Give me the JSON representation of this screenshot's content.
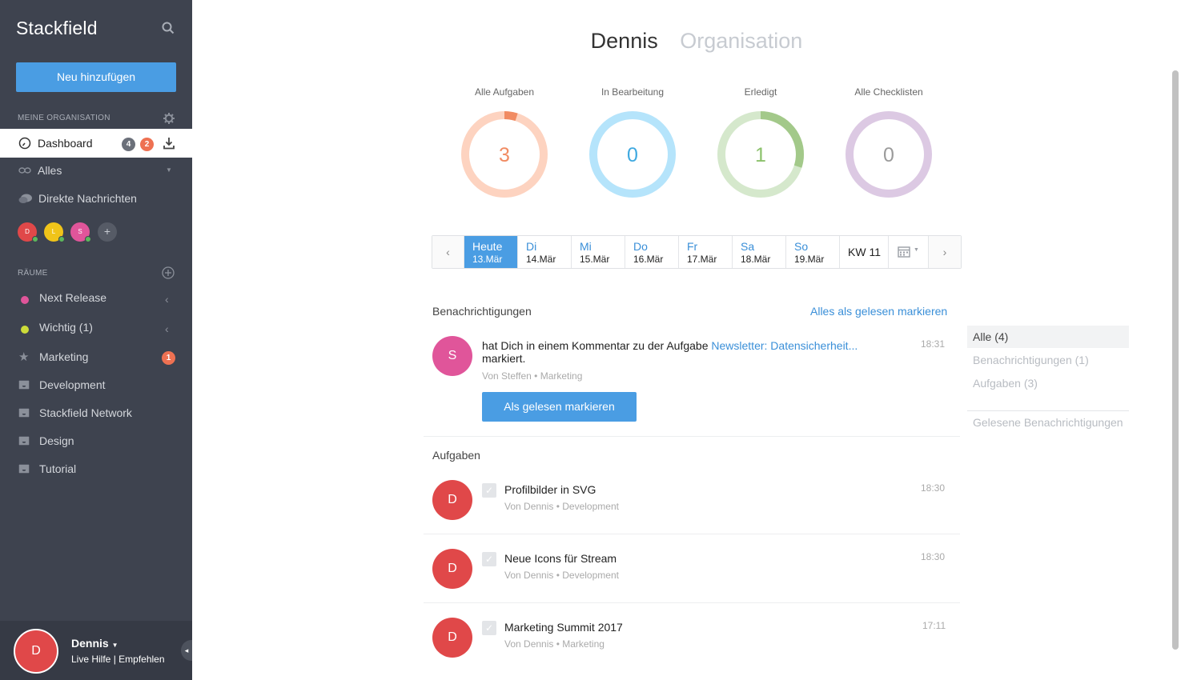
{
  "sidebar": {
    "brand": "Stackfield",
    "add_button": "Neu hinzufügen",
    "org_section": "MEINE ORGANISATION",
    "dashboard": {
      "label": "Dashboard",
      "badge_gray": "4",
      "badge_orange": "2"
    },
    "all": "Alles",
    "direct_messages": "Direkte Nachrichten",
    "avatars": [
      {
        "initial": "D",
        "color": "#e04849"
      },
      {
        "initial": "L",
        "color": "#f0c419"
      },
      {
        "initial": "S",
        "color": "#e0559a"
      }
    ],
    "rooms_section": "RÄUME",
    "rooms": [
      {
        "label": "Next Release",
        "dot_color": "#e0559a"
      },
      {
        "label": "Wichtig (1)",
        "dot_color": "#cddc39"
      },
      {
        "label": "Marketing",
        "badge": "1"
      },
      {
        "label": "Development"
      },
      {
        "label": "Stackfield Network"
      },
      {
        "label": "Design"
      },
      {
        "label": "Tutorial"
      }
    ],
    "user": {
      "initial": "D",
      "name": "Dennis",
      "links": "Live Hilfe | Empfehlen"
    }
  },
  "header": {
    "active_tab": "Dennis",
    "other_tab": "Organisation"
  },
  "stats": [
    {
      "title": "Alle Aufgaben",
      "value": "3",
      "color": "#f18b62",
      "track": "#fdd3c0"
    },
    {
      "title": "In Bearbeitung",
      "value": "0",
      "color": "#3fa9e0",
      "track": "#b5e4fb"
    },
    {
      "title": "Erledigt",
      "value": "1",
      "color": "#8bc16b",
      "track": "#d5e8cc"
    },
    {
      "title": "Alle Checklisten",
      "value": "0",
      "color": "#9b9b9b",
      "track": "#dcc9e3"
    }
  ],
  "calendar": {
    "days": [
      {
        "day": "Heute",
        "date": "13.Mär"
      },
      {
        "day": "Di",
        "date": "14.Mär"
      },
      {
        "day": "Mi",
        "date": "15.Mär"
      },
      {
        "day": "Do",
        "date": "16.Mär"
      },
      {
        "day": "Fr",
        "date": "17.Mär"
      },
      {
        "day": "Sa",
        "date": "18.Mär"
      },
      {
        "day": "So",
        "date": "19.Mär"
      }
    ],
    "week": "KW 11"
  },
  "notifications": {
    "title": "Benachrichtigungen",
    "mark_all": "Alles als gelesen markieren",
    "item": {
      "initial": "S",
      "text_before": "hat Dich in einem Kommentar zu der Aufgabe ",
      "link": "Newsletter: Datensicherheit...",
      "text_after": "markiert.",
      "meta": "Von Steffen • Marketing",
      "time": "18:31",
      "button": "Als gelesen markieren"
    }
  },
  "tasks": {
    "title": "Aufgaben",
    "items": [
      {
        "initial": "D",
        "title": "Profilbilder in SVG",
        "meta": "Von Dennis • Development",
        "time": "18:30"
      },
      {
        "initial": "D",
        "title": "Neue Icons für Stream",
        "meta": "Von Dennis • Development",
        "time": "18:30"
      },
      {
        "initial": "D",
        "title": "Marketing Summit 2017",
        "meta": "Von Dennis • Marketing",
        "time": "17:11"
      }
    ]
  },
  "filters": {
    "all": "Alle (4)",
    "notifications": "Benachrichtigungen (1)",
    "tasks": "Aufgaben (3)",
    "read": "Gelesene Benachrichtigungen"
  },
  "progress": {
    "alle_aufgaben_done_fraction": 0.05,
    "erledigt_fraction": 0.3
  }
}
